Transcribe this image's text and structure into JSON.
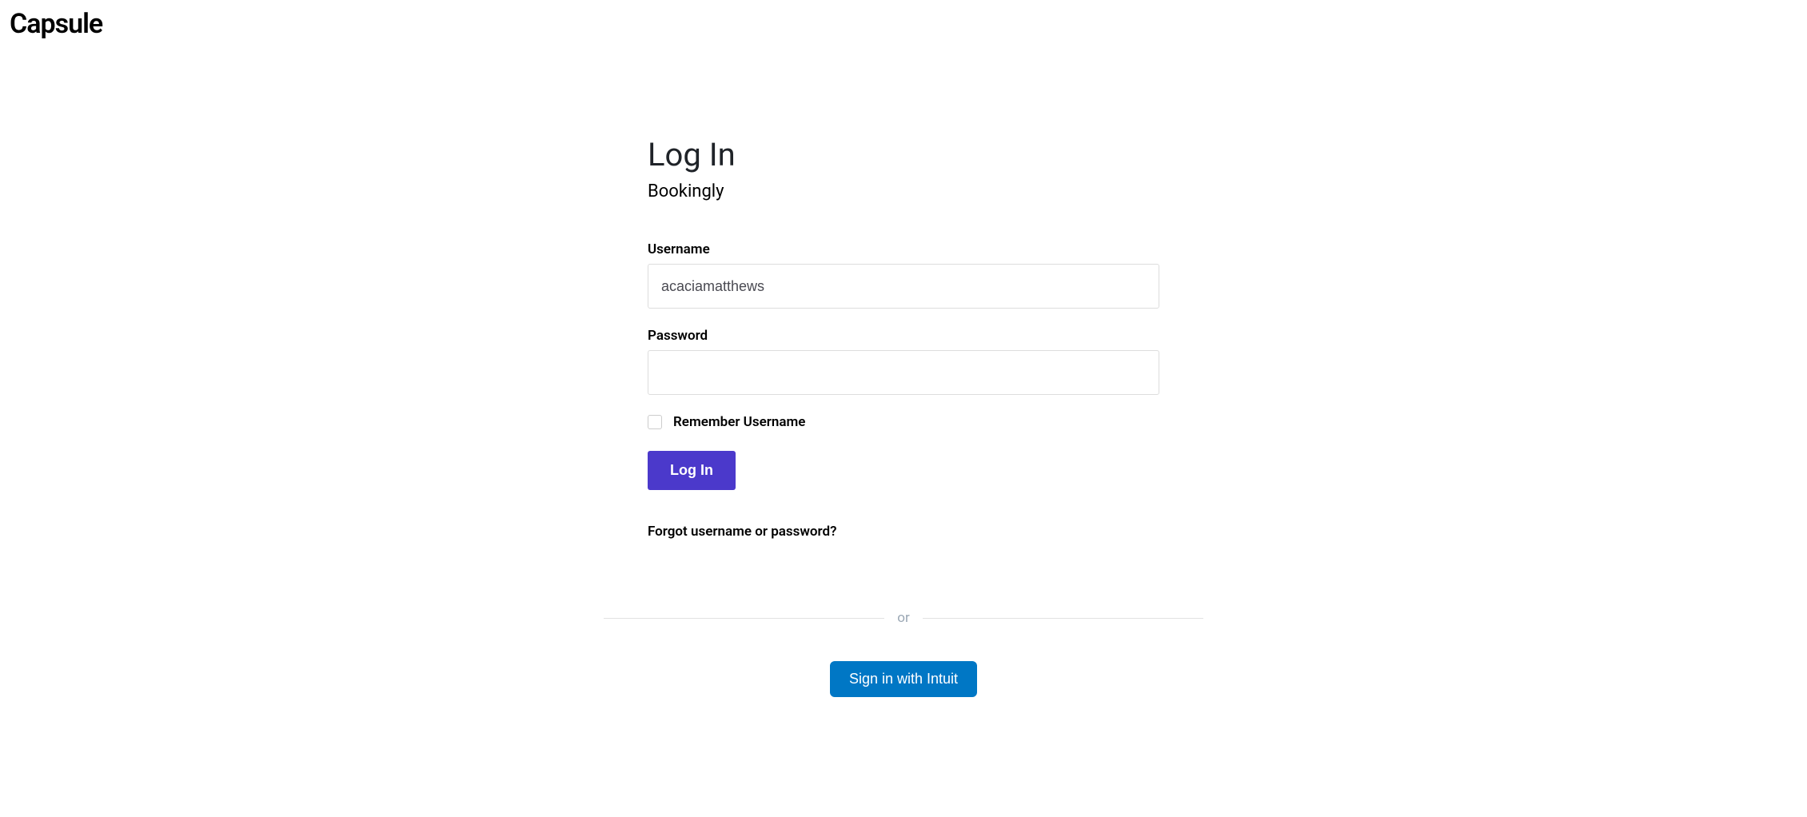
{
  "brand": {
    "name": "Capsule"
  },
  "page": {
    "title": "Log In",
    "subtitle": "Bookingly"
  },
  "form": {
    "username_label": "Username",
    "username_value": "acaciamatthews",
    "password_label": "Password",
    "password_value": "",
    "remember_label": "Remember Username",
    "submit_label": "Log In",
    "forgot_label": "Forgot username or password?"
  },
  "divider": {
    "text": "or"
  },
  "sso": {
    "intuit_label": "Sign in with Intuit"
  }
}
